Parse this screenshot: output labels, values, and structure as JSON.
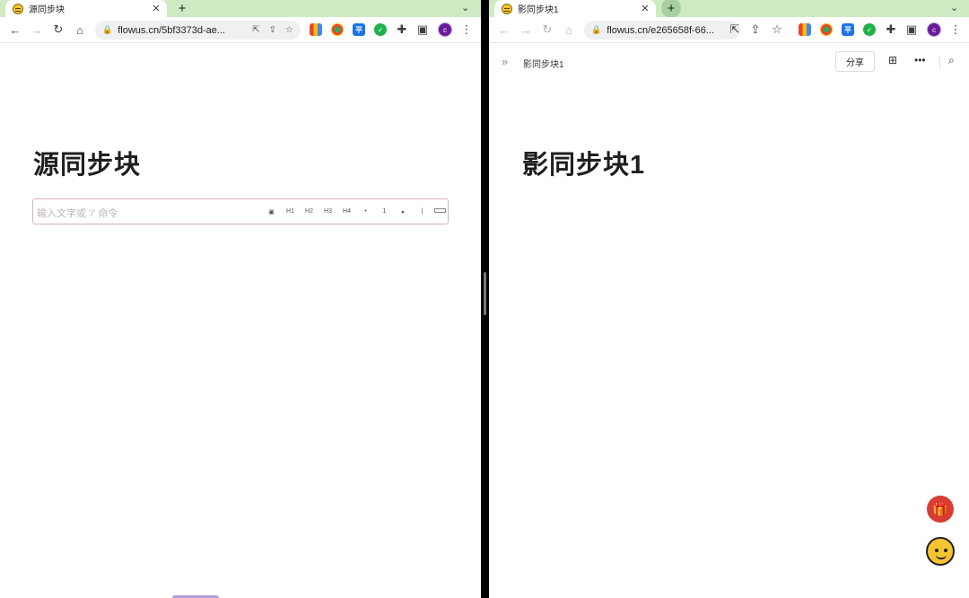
{
  "left": {
    "tab_title": "源同步块",
    "tab_close": "✕",
    "new_tab": "+",
    "tab_menu": "⌄",
    "url": "flowus.cn/5bf3373d-ae...",
    "page_title": "源同步块",
    "editor_placeholder": "输入文字或 '/' 命令",
    "editor_tools": [
      "▣",
      "H1",
      "H2",
      "H3",
      "H4",
      "•",
      "1",
      "▸",
      "|"
    ]
  },
  "right": {
    "tab_title": "影同步块1",
    "tab_close": "✕",
    "new_tab": "+",
    "tab_menu": "⌄",
    "url": "flowus.cn/e265658f-66...",
    "breadcrumb": "影同步块1",
    "share_label": "分享",
    "page_title": "影同步块1"
  },
  "icons": {
    "back": "←",
    "forward": "→",
    "reload": "↻",
    "home": "⌂",
    "lock": "🔒",
    "open_external": "⇱",
    "share": "⇪",
    "star": "☆",
    "puzzle": "✚",
    "side_panel": "▣",
    "menu": "⋮",
    "sidebar_toggle": "»",
    "bookmark": "⊞",
    "more": "•••",
    "search": "⌕",
    "gift": "🎁"
  },
  "extensions": {
    "blue_label": "平",
    "green_label": "✓"
  },
  "avatar_letter": "c"
}
